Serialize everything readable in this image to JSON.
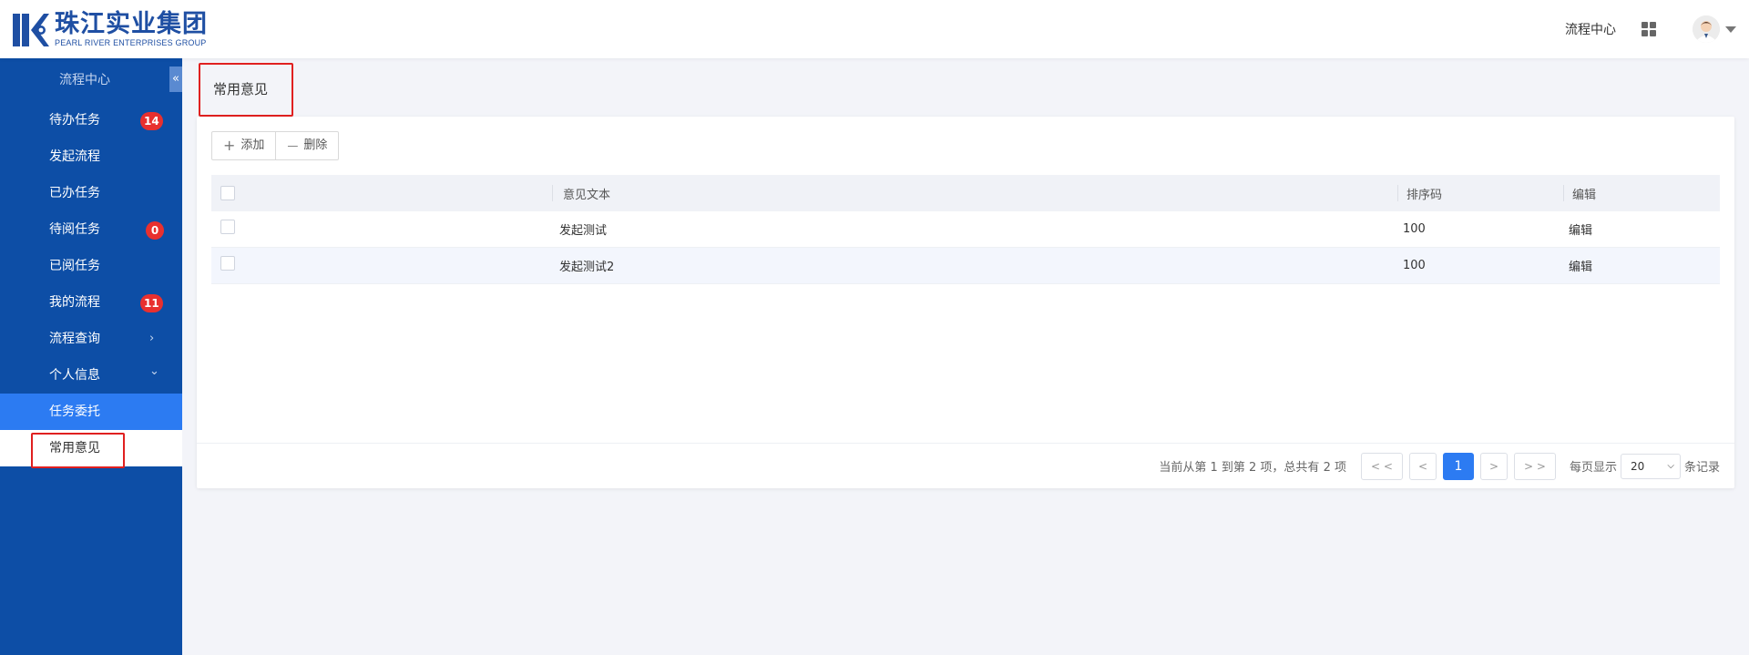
{
  "header": {
    "logo_cn": "珠江实业集团",
    "logo_en": "PEARL RIVER ENTERPRISES GROUP",
    "nav_link": "流程中心",
    "apps_icon": "grid-icon",
    "avatar_icon": "user-avatar",
    "dropdown_icon": "caret-down-icon"
  },
  "sidebar": {
    "title": "流程中心",
    "collapse_symbol": "«",
    "items": [
      {
        "label": "待办任务",
        "badge": "14"
      },
      {
        "label": "发起流程"
      },
      {
        "label": "已办任务"
      },
      {
        "label": "待阅任务",
        "badge": "0"
      },
      {
        "label": "已阅任务"
      },
      {
        "label": "我的流程",
        "badge": "11"
      },
      {
        "label": "流程查询",
        "arrow": "›"
      },
      {
        "label": "个人信息",
        "arrow": "⌄"
      },
      {
        "label": "任务委托"
      },
      {
        "label": "常用意见"
      }
    ]
  },
  "main": {
    "page_title": "常用意见",
    "toolbar": {
      "add_label": "添加",
      "add_symbol": "+",
      "delete_label": "删除",
      "delete_symbol": "—"
    },
    "table": {
      "columns": [
        "意见文本",
        "排序码",
        "编辑"
      ],
      "rows": [
        {
          "text": "发起测试",
          "sort": "100",
          "edit": "编辑"
        },
        {
          "text": "发起测试2",
          "sort": "100",
          "edit": "编辑"
        }
      ]
    },
    "pager": {
      "info": "当前从第 1 到第 2 项，总共有 2 项",
      "first": "< <",
      "prev": "<",
      "current": "1",
      "next": ">",
      "last": "> >",
      "size_label": "每页显示",
      "size_value": "20",
      "size_suffix": "条记录"
    }
  },
  "colors": {
    "sidebar_bg": "#0d4ea6",
    "accent": "#2c7bf2",
    "badge": "#e8302f",
    "highlight_box": "#e02020"
  }
}
